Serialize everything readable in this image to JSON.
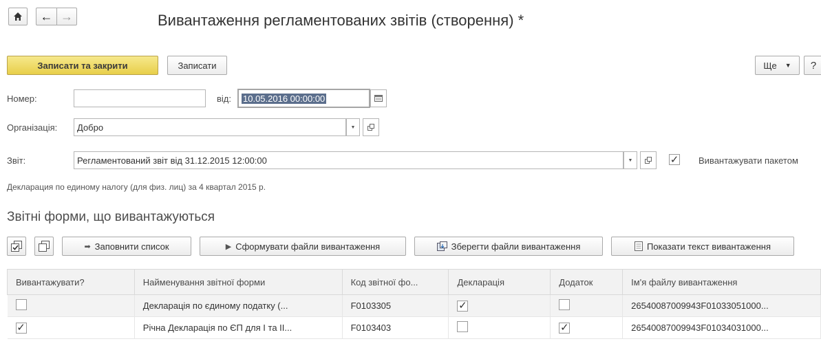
{
  "nav": {
    "home_icon": "home-icon",
    "back_arrow": "←",
    "forward_arrow": "→"
  },
  "window": {
    "title": "Вивантаження регламентованих звітів (створення) *"
  },
  "toolbar": {
    "save_close_label": "Записати та закрити",
    "save_label": "Записати",
    "more_label": "Ще",
    "help_label": "?"
  },
  "form": {
    "number_label": "Номер:",
    "number_value": "",
    "date_label": "від:",
    "date_value": "10.05.2016 00:00:00",
    "org_label": "Організація:",
    "org_value": "Добро",
    "report_label": "Звіт:",
    "report_value": "Регламентований звіт від 31.12.2015 12:00:00",
    "batch_checked": true,
    "batch_label": "Вивантажувати пакетом",
    "description": "Декларация по единому налогу (для физ. лиц) за 4 квартал 2015 р."
  },
  "section": {
    "title": "Звітні форми, що вивантажуються"
  },
  "table_toolbar": {
    "fill_label": "Заповнити список",
    "generate_label": "Сформувати файли вивантаження",
    "save_files_label": "Зберегти файли вивантаження",
    "show_text_label": "Показати текст вивантаження"
  },
  "table": {
    "columns": [
      "Вивантажувати?",
      "Найменування звітної форми",
      "Код звітної фо...",
      "Декларація",
      "Додаток",
      "Ім'я файлу вивантаження"
    ],
    "rows": [
      {
        "export": false,
        "name": "Декларація по єдиному податку (...",
        "code": "F0103305",
        "declaration": true,
        "attachment": false,
        "filename": "26540087009943F01033051000..."
      },
      {
        "export": true,
        "name": "Річна Декларація по ЄП для І та ІІ...",
        "code": "F0103403",
        "declaration": false,
        "attachment": true,
        "filename": "26540087009943F01034031000..."
      }
    ]
  }
}
